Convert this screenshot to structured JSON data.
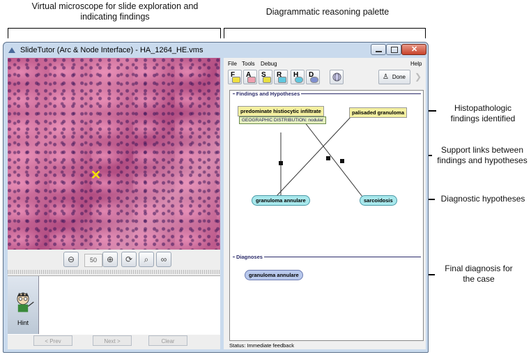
{
  "annotations": {
    "microscope_caption": "Virtual microscope for slide exploration and\nindicating findings",
    "palette_caption": "Diagrammatic reasoning palette",
    "findings_callout": "Histopathologic\nfindings identified",
    "support_callout": "Support links between\nfindings and hypotheses",
    "hypotheses_callout": "Diagnostic hypotheses",
    "diagnosis_callout": "Final diagnosis for\nthe case"
  },
  "window": {
    "title": "SlideTutor (Arc & Node Interface) - HA_1264_HE.vms"
  },
  "microscope": {
    "zoom_value": "50",
    "hint_label": "Hint",
    "prev_label": "< Prev",
    "next_label": "Next >",
    "clear_label": "Clear"
  },
  "palette": {
    "menu": {
      "file": "File",
      "tools": "Tools",
      "debug": "Debug",
      "help": "Help"
    },
    "tools": [
      {
        "letter": "F",
        "color": "#f0e040"
      },
      {
        "letter": "A",
        "color": "#f0a0b0"
      },
      {
        "letter": "S",
        "color": "#e8e040"
      },
      {
        "letter": "R",
        "color": "#e8e040"
      },
      {
        "letter": "H",
        "color": "#60c8e0"
      },
      {
        "letter": "D",
        "color": "#8090d0"
      }
    ],
    "done_label": "Done",
    "findings_section": "Findings and Hypotheses",
    "diagnoses_section": "Diagnoses",
    "findings": {
      "histiocytic": "predominate histiocytic infiltrate",
      "geo_attr": "GEOGRAPHIC DISTRIBUTION: nodular",
      "palisaded": "palisaded granuloma"
    },
    "hypotheses": {
      "granuloma": "granuloma annulare",
      "sarcoidosis": "sarcoidosis"
    },
    "diagnosis": "granuloma annulare",
    "status": "Status: Immediate feedback"
  }
}
